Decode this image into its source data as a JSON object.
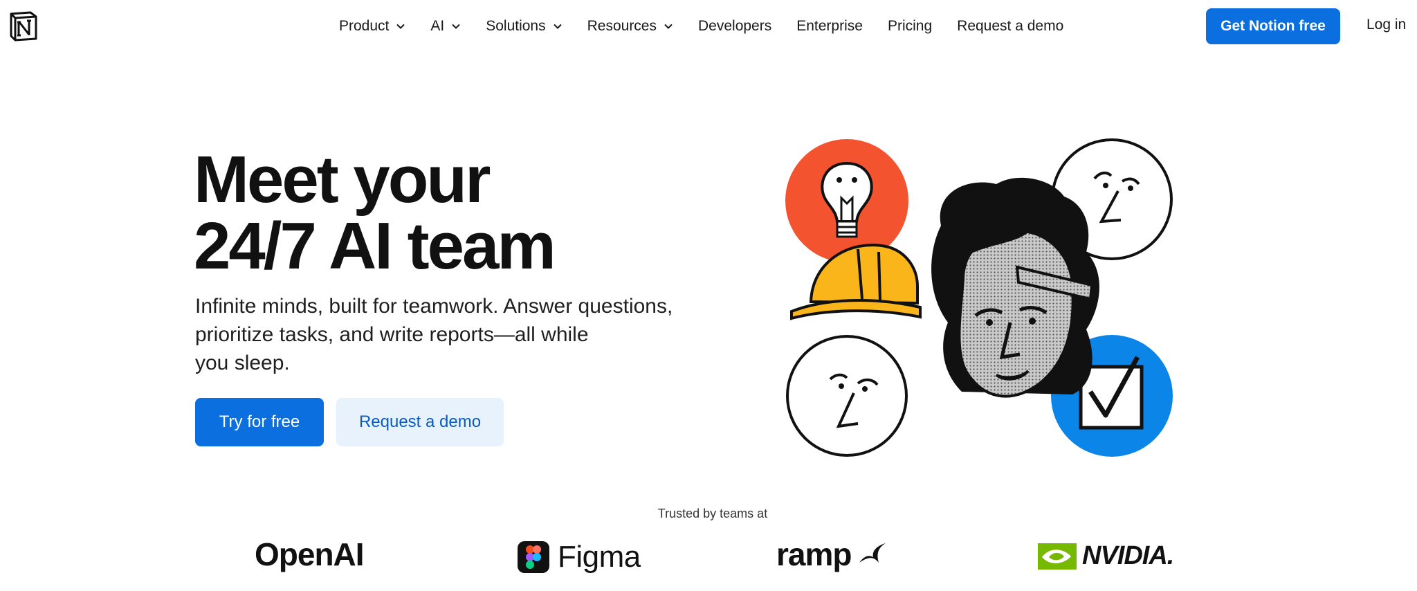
{
  "nav": {
    "items": [
      {
        "label": "Product",
        "dropdown": true
      },
      {
        "label": "AI",
        "dropdown": true
      },
      {
        "label": "Solutions",
        "dropdown": true
      },
      {
        "label": "Resources",
        "dropdown": true
      },
      {
        "label": "Developers",
        "dropdown": false
      },
      {
        "label": "Enterprise",
        "dropdown": false
      },
      {
        "label": "Pricing",
        "dropdown": false
      },
      {
        "label": "Request a demo",
        "dropdown": false
      }
    ],
    "cta_label": "Get Notion free",
    "login_label": "Log in",
    "logo_icon": "notion-logo-icon"
  },
  "hero": {
    "title_line1": "Meet your",
    "title_line2": "24/7 AI team",
    "subtitle_line1": "Infinite minds, built for teamwork. Answer questions,",
    "subtitle_line2": "prioritize tasks, and write reports—all while",
    "subtitle_line3": "you sleep.",
    "primary_button": "Try for free",
    "secondary_button": "Request a demo"
  },
  "trusted": {
    "label": "Trusted by teams at",
    "brands": [
      "OpenAI",
      "Figma",
      "ramp",
      "NVIDIA."
    ]
  },
  "colors": {
    "accent": "#0b6fe0",
    "accent_light": "#e8f2fd",
    "orange": "#f4532f",
    "yellow": "#f9b51a",
    "blue_circle": "#0b85e8",
    "nvidia_green": "#76b900"
  }
}
